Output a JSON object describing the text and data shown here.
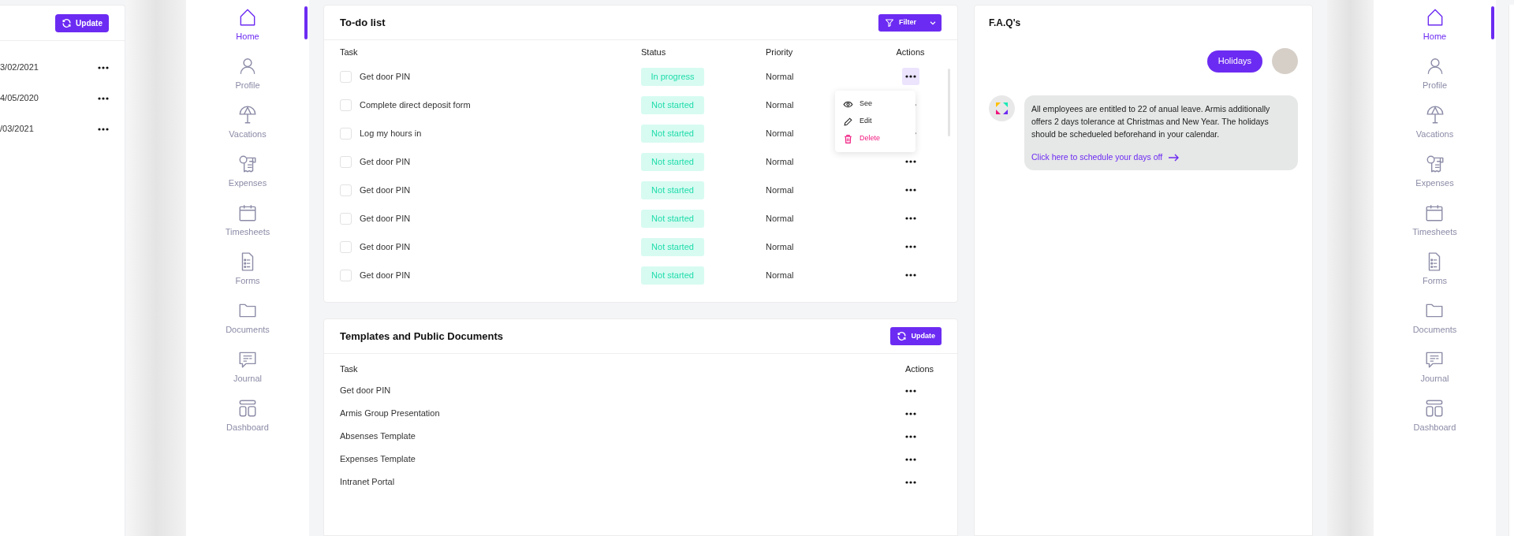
{
  "left_panel": {
    "update_button": "Update",
    "rows": [
      {
        "date": "3/02/2021"
      },
      {
        "date": "4/05/2020"
      },
      {
        "date": "/03/2021"
      }
    ]
  },
  "sidebars": [
    {
      "items": [
        {
          "label": "Home",
          "selected": true
        },
        {
          "label": "Profile",
          "selected": false
        },
        {
          "label": "Vacations",
          "selected": false
        },
        {
          "label": "Expenses",
          "selected": false
        },
        {
          "label": "Timesheets",
          "selected": false
        },
        {
          "label": "Forms",
          "selected": false
        },
        {
          "label": "Documents",
          "selected": false
        },
        {
          "label": "Journal",
          "selected": false
        },
        {
          "label": "Dashboard",
          "selected": false
        }
      ]
    },
    {
      "items": [
        {
          "label": "Home",
          "selected": true
        },
        {
          "label": "Profile",
          "selected": false
        },
        {
          "label": "Vacations",
          "selected": false
        },
        {
          "label": "Expenses",
          "selected": false
        },
        {
          "label": "Timesheets",
          "selected": false
        },
        {
          "label": "Forms",
          "selected": false
        },
        {
          "label": "Documents",
          "selected": false
        },
        {
          "label": "Journal",
          "selected": false
        },
        {
          "label": "Dashboard",
          "selected": false
        }
      ]
    }
  ],
  "todo": {
    "title": "To-do list",
    "filter_button": "Filter",
    "columns": [
      "Task",
      "Status",
      "Priority",
      "Actions"
    ],
    "rows": [
      {
        "task": "Get door PIN",
        "checked": false,
        "status": "In progress",
        "priority": "Normal",
        "menu_open": true
      },
      {
        "task": "Complete direct deposit form",
        "checked": false,
        "status": "Not started",
        "priority": "Normal",
        "menu_open": false
      },
      {
        "task": "Log my hours in",
        "checked": false,
        "status": "Not started",
        "priority": "Normal",
        "menu_open": false
      },
      {
        "task": "Get door PIN",
        "checked": false,
        "status": "Not started",
        "priority": "Normal",
        "menu_open": false
      },
      {
        "task": "Get door PIN",
        "checked": false,
        "status": "Not started",
        "priority": "Normal",
        "menu_open": false
      },
      {
        "task": "Get door PIN",
        "checked": false,
        "status": "Not started",
        "priority": "Normal",
        "menu_open": false
      },
      {
        "task": "Get door PIN",
        "checked": false,
        "status": "Not started",
        "priority": "Normal",
        "menu_open": false
      },
      {
        "task": "Get door PIN",
        "checked": false,
        "status": "Not started",
        "priority": "Normal",
        "menu_open": false
      }
    ],
    "menu": [
      {
        "label": "See",
        "kind": "view"
      },
      {
        "label": "Edit",
        "kind": "edit"
      },
      {
        "label": "Delete",
        "kind": "delete"
      }
    ]
  },
  "templates": {
    "title": "Templates and Public Documents",
    "update_button": "Update",
    "columns": [
      "Task",
      "Actions"
    ],
    "rows": [
      "Get door PIN",
      "Armis Group Presentation",
      "Absenses Template",
      "Expenses Template",
      "Intranet Portal"
    ]
  },
  "faq": {
    "title": "F.A.Q's",
    "question": "Holidays",
    "answer": "All employees are entitled to 22 of anual leave. Armis additionally offers 2 days tolerance at Christmas and New Year. The holidays should be schedueled beforehand in your calendar.",
    "link": "Click here to schedule your days off"
  }
}
